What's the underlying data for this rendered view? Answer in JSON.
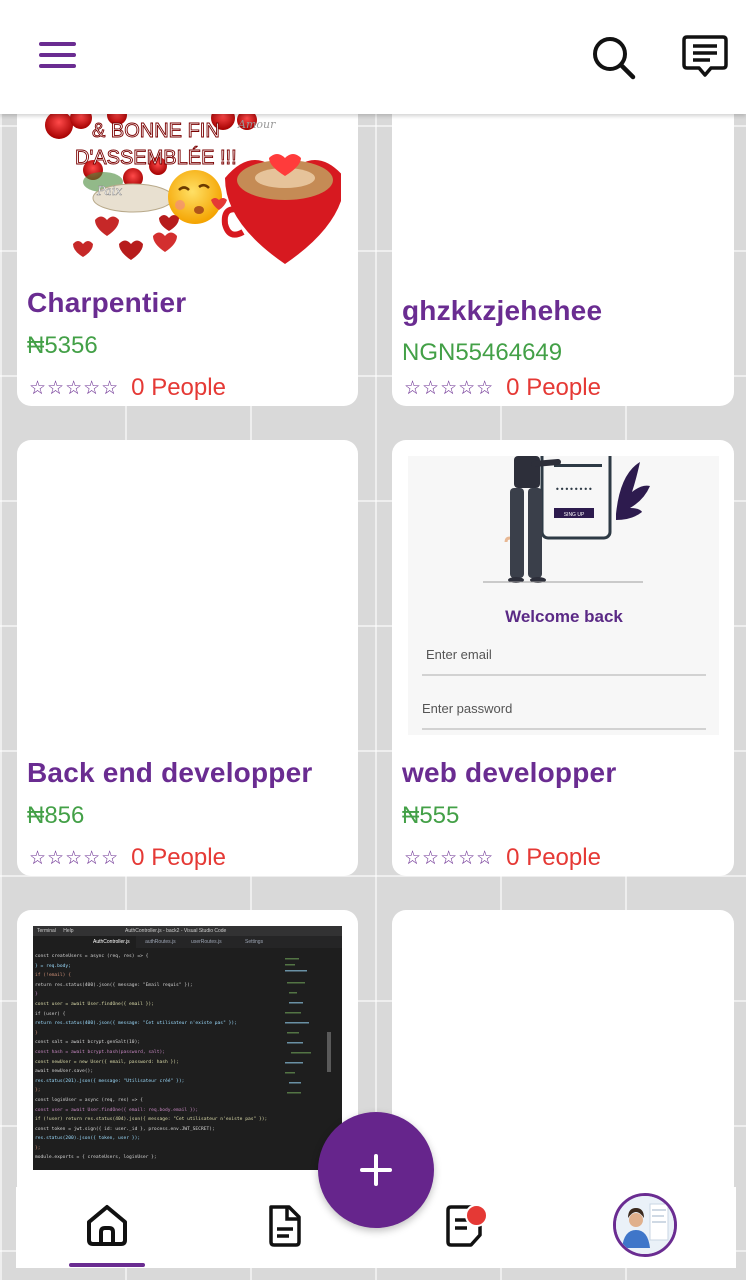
{
  "colors": {
    "accent": "#6a2c91",
    "fab": "#66258c",
    "price": "#43a047",
    "people": "#e53935",
    "background": "#d9d9d9"
  },
  "header": {
    "menu_icon": "hamburger-menu-icon",
    "search_icon": "search-icon",
    "chat_icon": "message-icon"
  },
  "cards": [
    {
      "title": "Charpentier",
      "price": "₦5356",
      "stars": "☆☆☆☆☆",
      "people": "0 People",
      "image": {
        "line1": "& BONNE FIN",
        "line2": "D'ASSEMBLÉE !!!"
      }
    },
    {
      "title": "ghzkkzjehehee",
      "price": "NGN55464649",
      "stars": "☆☆☆☆☆",
      "people": "0 People"
    },
    {
      "title": "Back end developper",
      "price": "₦856",
      "stars": "☆☆☆☆☆",
      "people": "0 People"
    },
    {
      "title": "web developper",
      "price": "₦555",
      "stars": "☆☆☆☆☆",
      "people": "0 People",
      "image": {
        "welcome": "Welcome back",
        "email_placeholder": "Enter email",
        "password_placeholder": "Enter password",
        "button": "SING UP",
        "password_dots": "••••••••"
      }
    },
    {
      "image": {
        "menu1": "Terminal",
        "menu2": "Help",
        "window_title": "AuthController.js - back2 - Visual Studio Code",
        "tab1": "AuthController.js",
        "tab2": "authRoutes.js",
        "tab3": "userRoutes.js",
        "tab4": "Settings",
        "code_lines": [
          "const createUsers = async (req, res) => {",
          "  } = req.body;",
          "  if (!email) {",
          "    return res.status(400).json({ message: \"Email requis\" });",
          "  }",
          "  const user = await User.findOne({ email });",
          "  if (user) {",
          "    return res.status(400).json({ message: \"Cet utilisateur n'existe pas\" });",
          "  }",
          "  const salt = await bcrypt.genSalt(10);",
          "  const hash = await bcrypt.hash(password, salt);",
          "  const newUser = new User({ email, password: hash });",
          "  await newUser.save();",
          "  res.status(201).json({ message: \"Utilisateur créé\" });",
          "};",
          "const loginUser = async (req, res) => {",
          "  const user = await User.findOne({ email: req.body.email });",
          "  if (!user) return res.status(404).json({ message: \"Cet utilisateur n'existe pas\" });",
          "  const token = jwt.sign({ id: user._id }, process.env.JWT_SECRET);",
          "  res.status(200).json({ token, user });",
          "};",
          "module.exports = { createUsers, loginUser };"
        ]
      }
    },
    {}
  ],
  "fab": {
    "icon": "plus-icon"
  },
  "bottom_nav": {
    "items": [
      "home-icon",
      "document-icon",
      "notes-icon",
      "profile-avatar"
    ],
    "active_index": 0
  }
}
